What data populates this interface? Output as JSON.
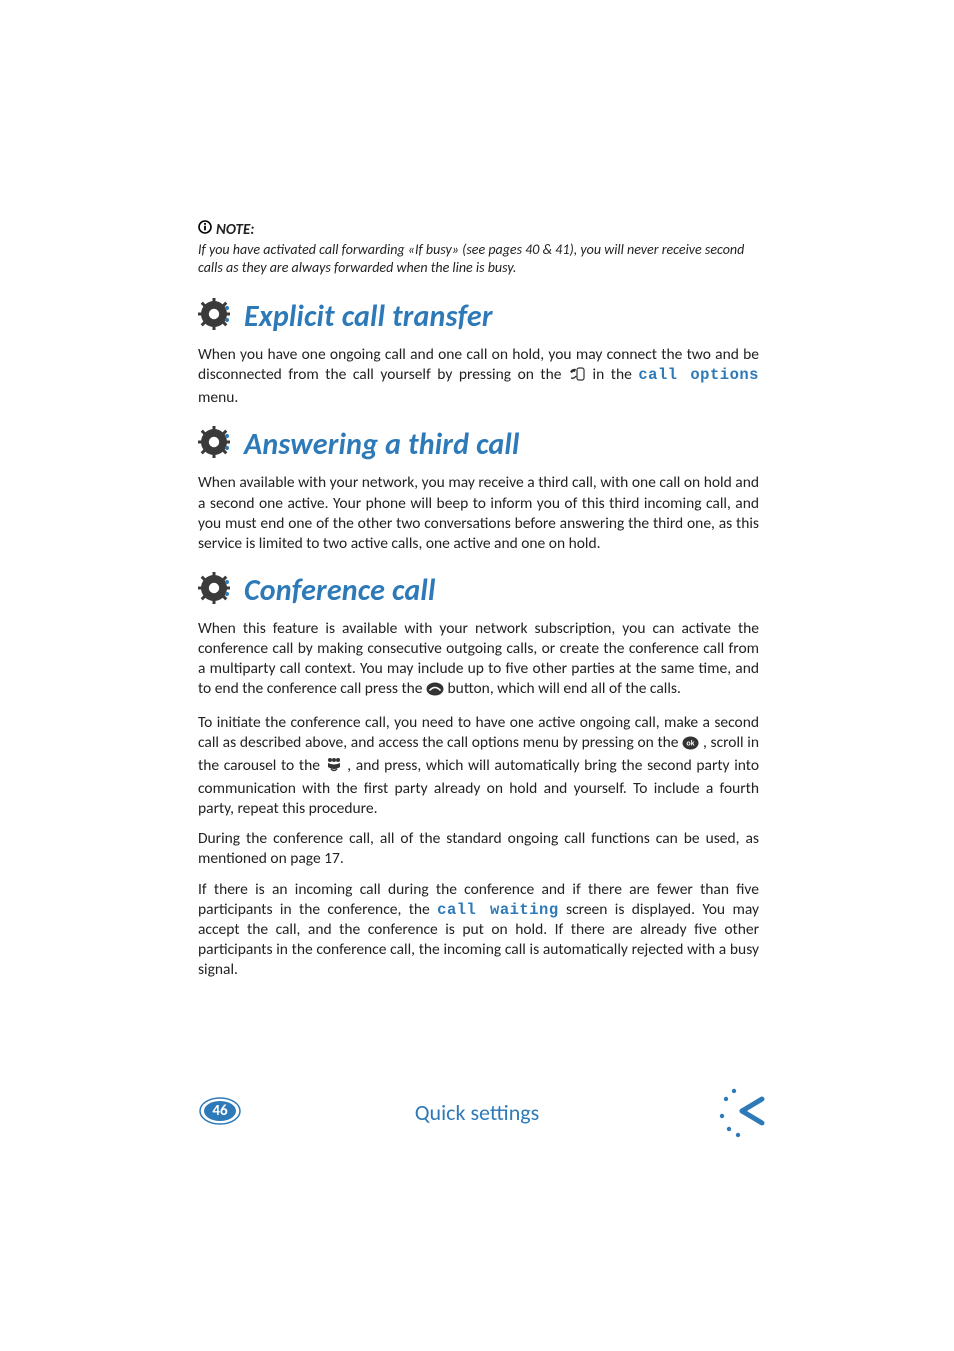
{
  "note": {
    "label": "NOTE:",
    "text": "If you have activated call forwarding «If busy» (see pages 40 & 41), you will never receive second calls as they are always forwarded when the line is busy."
  },
  "sections": {
    "explicit": {
      "heading": "Explicit call transfer",
      "para_a": "When you have one ongoing call and one call on hold, you may connect the two and be disconnected from the call yourself by pressing on the ",
      "para_b": " in the ",
      "mono": "call options",
      "para_c": " menu."
    },
    "answering": {
      "heading": "Answering a third call",
      "para": "When available with your network, you may receive a third call, with one call on hold and a second one active.  Your phone will beep to inform you of this third incoming call, and you must end one of the other two conversations before answering the third one, as this service is limited to two active calls, one active and one on hold."
    },
    "conference": {
      "heading": "Conference call",
      "p1_a": "When this feature is available with your network subscription, you can activate the conference call by making consecutive outgoing calls, or create the conference call from a multiparty call context.  You may include up to five other parties at the same time, and to end the conference call press the ",
      "p1_b": " button, which will end all of the calls.",
      "p2_a": "To initiate the conference call, you need to have one active ongoing call, make a second call as described above, and access the call options menu by pressing on the ",
      "p2_b": " , scroll in the carousel to the ",
      "p2_c": " , and press, which will automatically bring the second party into communication with the first party already on hold and yourself.  To include a fourth party, repeat this procedure.",
      "p3": "During the conference call, all of the standard ongoing call functions can be used, as mentioned on page 17.",
      "p4_a": "If there is an incoming call during the conference and if there are fewer than five participants in the conference, the ",
      "p4_mono": "call waiting",
      "p4_b": " screen is displayed.  You may accept the call, and the conference is put on hold. If there are already five other participants in the conference call, the incoming call is automatically rejected with a busy signal."
    }
  },
  "footer": {
    "page_number": "46",
    "section_title": "Quick settings"
  }
}
